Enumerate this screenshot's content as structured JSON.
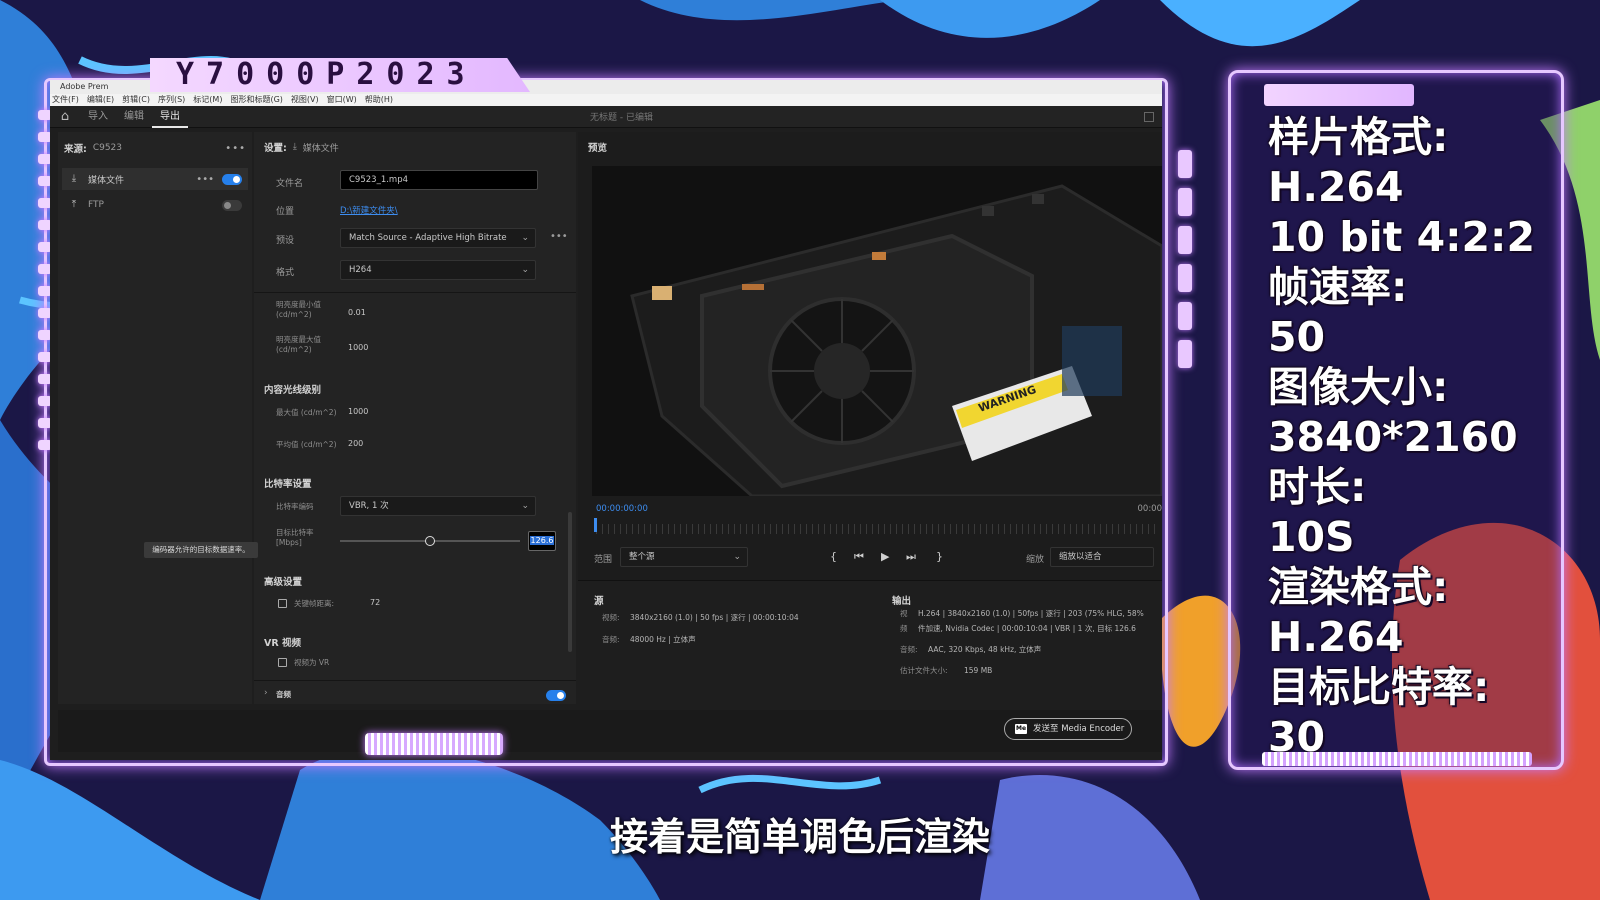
{
  "banner": {
    "title": "Y7000P2023"
  },
  "window": {
    "app_title": "Adobe Prem",
    "menu": [
      "文件(F)",
      "编辑(E)",
      "剪辑(C)",
      "序列(S)",
      "标记(M)",
      "图形和标题(G)",
      "视图(V)",
      "窗口(W)",
      "帮助(H)"
    ],
    "tabs": [
      "导入",
      "编辑",
      "导出"
    ],
    "active_tab": "导出",
    "doc_title": "无标题 - 已编辑"
  },
  "left_panel": {
    "source_label": "来源:",
    "source_value": "C9523",
    "destinations": [
      {
        "label": "媒体文件",
        "enabled": true
      },
      {
        "label": "FTP",
        "enabled": false
      }
    ]
  },
  "settings": {
    "header": "设置:",
    "header_target": "媒体文件",
    "filename_label": "文件名",
    "filename_value": "C9523_1.mp4",
    "location_label": "位置",
    "location_value": "D:\\新建文件夹\\",
    "preset_label": "预设",
    "preset_value": "Match Source - Adaptive High Bitrate",
    "format_label": "格式",
    "format_value": "H264",
    "lum_min_label": "明亮度最小值",
    "lum_min_unit": "(cd/m^2)",
    "lum_min_value": "0.01",
    "lum_max_label": "明亮度最大值",
    "lum_max_unit": "(cd/m^2)",
    "lum_max_value": "1000",
    "content_light_header": "内容光线级别",
    "max_label": "最大值 (cd/m^2)",
    "max_value": "1000",
    "avg_label": "平均值 (cd/m^2)",
    "avg_value": "200",
    "bitrate_header": "比特率设置",
    "bitrate_encoding_label": "比特率编码",
    "bitrate_encoding_value": "VBR, 1 次",
    "target_bitrate_label": "目标比特率",
    "target_bitrate_unit": "[Mbps]",
    "target_bitrate_value": "126.6",
    "target_bitrate_fraction": 0.5,
    "tooltip": "编码器允许的目标数据速率。",
    "advanced_header": "高级设置",
    "keyframe_label": "关键帧距离:",
    "keyframe_value": "72",
    "vr_header": "VR 视频",
    "vr_label": "视频为 VR",
    "audio_label": "音频"
  },
  "preview": {
    "header": "预览",
    "warning_text": "WARNING",
    "timecode_start": "00:00:00:00",
    "timecode_end": "00:00",
    "range_label": "范围",
    "range_value": "整个源",
    "zoom_label": "缩放",
    "zoom_value": "缩放以适合"
  },
  "summary": {
    "source_header": "源",
    "source_video_label": "视频:",
    "source_video": "3840x2160 (1.0) | 50 fps | 逐行 | 00:00:10:04",
    "source_audio_label": "音频:",
    "source_audio": "48000 Hz | 立体声",
    "output_header": "输出",
    "output_video_label": "视",
    "output_video": "H.264 | 3840x2160 (1.0) | 50fps | 逐行 | 203 (75% HLG, 58%",
    "output_video2_label": "频",
    "output_video2": "件加速, Nvidia Codec | 00:00:10:04 | VBR | 1 次, 目标 126.6",
    "output_audio_label": "音频:",
    "output_audio": "AAC, 320 Kbps, 48 kHz, 立体声",
    "filesize_label": "估计文件大小:",
    "filesize": "159 MB"
  },
  "footer": {
    "send_label": "发送至 Media Encoder",
    "me_icon": "Me"
  },
  "info_panel": {
    "lines": [
      "样片格式:",
      "H.264",
      "10 bit 4:2:2",
      "帧速率:",
      "50",
      "图像大小:",
      "3840*2160",
      "时长:",
      "10S",
      "渲染格式:",
      "H.264",
      "目标比特率:",
      "30"
    ]
  },
  "subtitle": "接着是简单调色后渲染",
  "colors": {
    "accent": "#2680eb",
    "frame_glow": "#c47bff",
    "banner": "#f4d8ff"
  }
}
